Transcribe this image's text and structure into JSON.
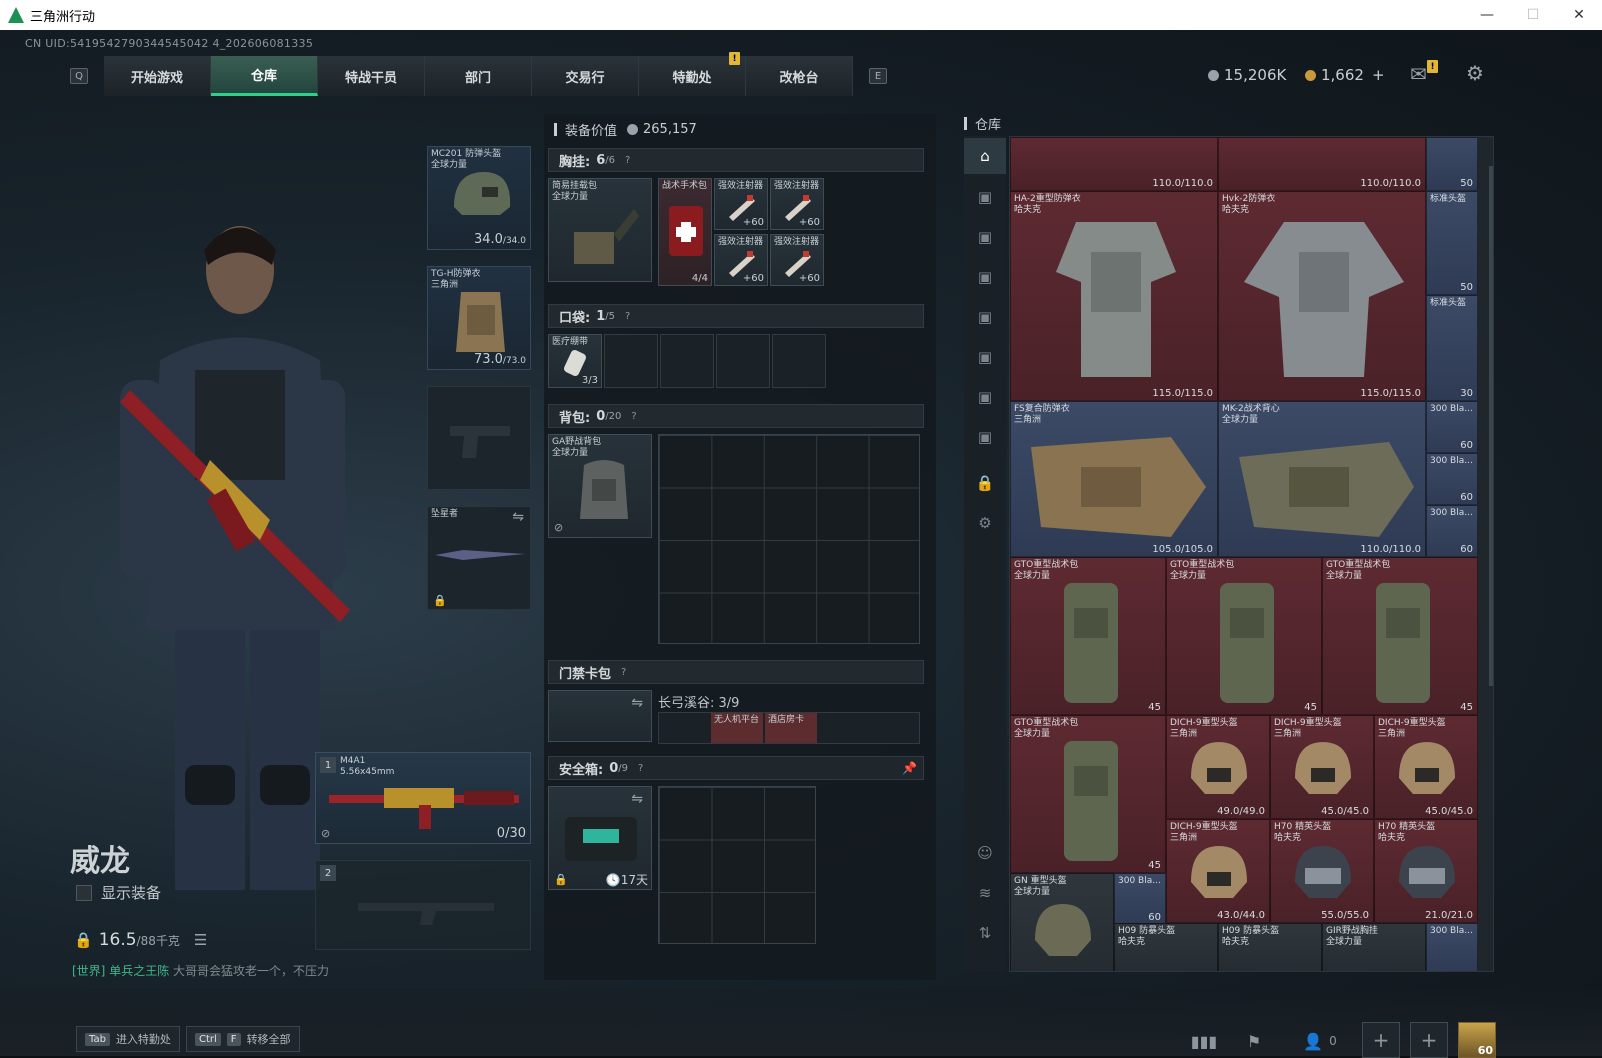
{
  "window": {
    "title": "三角洲行动"
  },
  "uid": "CN UID:5419542790344545042 4_202606081335",
  "nav": {
    "key_left": "Q",
    "key_right": "E",
    "tabs": [
      "开始游戏",
      "仓库",
      "特战干员",
      "部门",
      "交易行",
      "特勤处",
      "改枪台"
    ],
    "active_tab": "仓库",
    "badge": "!"
  },
  "currency": {
    "silver": "15,206K",
    "gold": "1,662",
    "plus": "+",
    "mail_badge": "!"
  },
  "character": {
    "name": "威龙",
    "show_equipment": "显示装备",
    "weight_current": "16.5",
    "weight_max": "/88千克"
  },
  "chat": {
    "channel": "[世界]",
    "name": "单兵之王陈",
    "msg": "大哥哥会猛攻老一个，不压力"
  },
  "equip_slots": {
    "helmet": {
      "name": "MC201 防弹头盔",
      "sub": "全球力量",
      "cur": "34.0",
      "max": "/34.0"
    },
    "armor": {
      "name": "TG-H防弹衣",
      "sub": "三角洲",
      "cur": "73.0",
      "max": "/73.0"
    },
    "melee": {
      "name": "坠星者"
    }
  },
  "weapons": [
    {
      "num": "1",
      "name": "M4A1",
      "sub": "5.56x45mm",
      "ammo": "0/30"
    },
    {
      "num": "2",
      "name": "",
      "sub": "",
      "ammo": ""
    }
  ],
  "loadout": {
    "value_label": "装备价值",
    "value": "265,157",
    "rig_label": "胸挂:",
    "rig_count": "6",
    "rig_max": "/6",
    "rig_item": {
      "name": "简易挂载包",
      "sub": "全球力量"
    },
    "rig_items": [
      {
        "name": "战术手术包",
        "count": "4/4"
      },
      {
        "name": "强效注射器",
        "count": "+60"
      },
      {
        "name": "强效注射器",
        "count": "+60"
      },
      {
        "name": "强效注射器",
        "count": "+60"
      },
      {
        "name": "强效注射器",
        "count": "+60"
      }
    ],
    "pocket_label": "口袋:",
    "pocket_count": "1",
    "pocket_max": "/5",
    "pocket_item": {
      "name": "医疗绷带",
      "count": "3/3"
    },
    "backpack_label": "背包:",
    "backpack_count": "0",
    "backpack_max": "/20",
    "backpack_item": {
      "name": "GA野战背包",
      "sub": "全球力量"
    },
    "keycard_label": "门禁卡包",
    "keycard_map": "长弓溪谷: 3/9",
    "keycard_slots": [
      "无人机平台",
      "酒店房卡"
    ],
    "safe_label": "安全箱:",
    "safe_count": "0",
    "safe_max": "/9",
    "safe_timer": "17天",
    "help": "?"
  },
  "stash": {
    "title": "仓库",
    "items": [
      {
        "name": "",
        "sub": "",
        "val": "110.0/110.0"
      },
      {
        "name": "",
        "sub": "",
        "val": "110.0/110.0"
      },
      {
        "name": "",
        "sub": "",
        "val": "50"
      },
      {
        "name": "HA-2重型防弹衣",
        "sub": "哈夫克",
        "val": "115.0/115.0"
      },
      {
        "name": "Hvk-2防弹衣",
        "sub": "哈夫克",
        "val": "115.0/115.0"
      },
      {
        "name": "标准头盔",
        "sub": "",
        "val": "50"
      },
      {
        "name": "标准头盔",
        "sub": "",
        "val": "30"
      },
      {
        "name": "FS复合防弹衣",
        "sub": "三角洲",
        "val": "105.0/105.0"
      },
      {
        "name": "MK-2战术背心",
        "sub": "全球力量",
        "val": "110.0/110.0"
      },
      {
        "name": "300 Bla...",
        "sub": "",
        "val": "60"
      },
      {
        "name": "300 Bla...",
        "sub": "",
        "val": "60"
      },
      {
        "name": "300 Bla...",
        "sub": "",
        "val": "60"
      },
      {
        "name": "GTO重型战术包",
        "sub": "全球力量",
        "val": "45"
      },
      {
        "name": "GTO重型战术包",
        "sub": "全球力量",
        "val": "45"
      },
      {
        "name": "GTO重型战术包",
        "sub": "全球力量",
        "val": "45"
      },
      {
        "name": "GTO重型战术包",
        "sub": "全球力量",
        "val": "45"
      },
      {
        "name": "DICH-9重型头盔",
        "sub": "三角洲",
        "val": "49.0/49.0"
      },
      {
        "name": "DICH-9重型头盔",
        "sub": "三角洲",
        "val": "45.0/45.0"
      },
      {
        "name": "DICH-9重型头盔",
        "sub": "三角洲",
        "val": "45.0/45.0"
      },
      {
        "name": "DICH-9重型头盔",
        "sub": "三角洲",
        "val": "43.0/44.0"
      },
      {
        "name": "H70 精英头盔",
        "sub": "哈夫克",
        "val": "55.0/55.0"
      },
      {
        "name": "H70 精英头盔",
        "sub": "哈夫克",
        "val": "21.0/21.0"
      },
      {
        "name": "GN 重型头盔",
        "sub": "全球力量",
        "val": ""
      },
      {
        "name": "300 Bla...",
        "sub": "",
        "val": "60"
      },
      {
        "name": "H09 防暴头盔",
        "sub": "哈夫克",
        "val": ""
      },
      {
        "name": "H09 防暴头盔",
        "sub": "哈夫克",
        "val": ""
      },
      {
        "name": "GIR野战胸挂",
        "sub": "全球力量",
        "val": ""
      },
      {
        "name": "300 Bla...",
        "sub": "",
        "val": ""
      }
    ]
  },
  "bottom": {
    "tab_key": "Tab",
    "tab_label": "进入特勤处",
    "ctrl_key": "Ctrl",
    "f_key": "F",
    "transfer_label": "转移全部",
    "friends": "0",
    "avatar_level": "60"
  }
}
